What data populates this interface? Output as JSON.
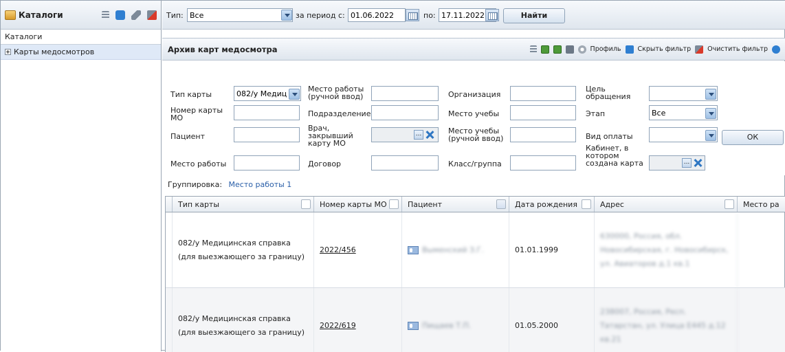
{
  "left_panel": {
    "title": "Каталоги",
    "subtitle": "Каталоги",
    "tree_items": [
      {
        "label": "Карты медосмотров"
      }
    ]
  },
  "top_filter": {
    "type_label": "Тип:",
    "type_value": "Все",
    "period_label": "за период с:",
    "date_from": "01.06.2022",
    "to_label": "по:",
    "date_to": "17.11.2022",
    "find_button": "Найти"
  },
  "main_panel": {
    "title": "Архив карт медосмотра",
    "toolbar": {
      "profile": "Профиль",
      "hide_filter": "Скрыть фильтр",
      "clear_filter": "Очистить фильтр"
    }
  },
  "filters": {
    "card_type_label": "Тип карты",
    "card_type_value": "082/у Медиц",
    "card_number_label": "Номер карты МО",
    "patient_label": "Пациент",
    "workplace_label": "Место работы",
    "workplace_manual_label": "Место работы (ручной ввод)",
    "department_label": "Подразделение",
    "doctor_label": "Врач, закрывший карту МО",
    "contract_label": "Договор",
    "organization_label": "Организация",
    "study_place_label": "Место учебы",
    "study_place_manual_label": "Место учебы (ручной ввод)",
    "class_group_label": "Класс/группа",
    "purpose_label": "Цель обращения",
    "stage_label": "Этап",
    "stage_value": "Все",
    "payment_label": "Вид оплаты",
    "cabinet_label": "Кабинет, в котором создана карта",
    "ok_button": "ОК"
  },
  "grouping": {
    "label": "Группировка:",
    "value": "Место работы 1"
  },
  "table": {
    "columns": [
      "Тип карты",
      "Номер карты МО",
      "Пациент",
      "Дата рождения",
      "Адрес",
      "Место ра"
    ],
    "rows": [
      {
        "type": "082/у Медицинская справка (для выезжающего за границу)",
        "number": "2022/456",
        "patient": "Выменский З.Г.",
        "birth": "01.01.1999",
        "address": "630000, Россия, обл. Новосибирская, г. Новосибирск, ул. Авиаторов д.1 кв.1"
      },
      {
        "type": "082/у Медицинская справка (для выезжающего за границу)",
        "number": "2022/619",
        "patient": "Пищаев Т.П.",
        "birth": "01.05.2000",
        "address": "238007, Россия, Респ. Татарстан, ул. Улица Е445 д.12 кв.21"
      }
    ]
  },
  "colors": {
    "header_gradient_top": "#f7f9fc",
    "header_gradient_bottom": "#dfe6ee",
    "selected_row": "#dfe9f7",
    "link": "#2a5fa8"
  }
}
